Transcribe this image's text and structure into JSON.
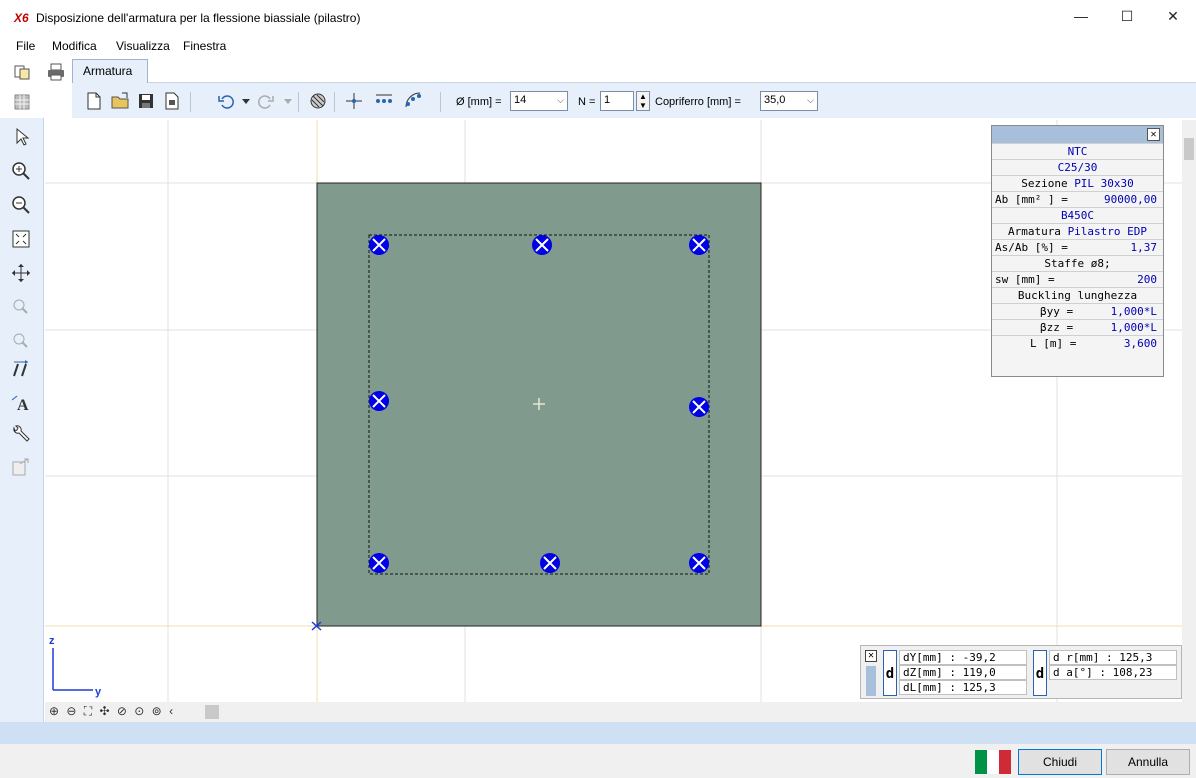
{
  "window": {
    "logo": "X6",
    "title": "Disposizione dell'armatura per la flessione biassiale (pilastro)",
    "minimize": "—",
    "maximize": "☐",
    "close": "✕"
  },
  "menu": {
    "file": "File",
    "modifica": "Modifica",
    "visualizza": "Visualizza",
    "finestra": "Finestra"
  },
  "tabs": {
    "armatura": "Armatura"
  },
  "toolbar": {
    "diameter_label": "Ø [mm] =",
    "diameter_value": "14",
    "n_label": "N =",
    "n_value": "1",
    "cover_label": "Copriferro [mm] =",
    "cover_value": "35,0"
  },
  "info_panel": {
    "norm": "NTC",
    "concrete": "C25/30",
    "section_label": "Sezione",
    "section_value": "PIL 30x30",
    "ab_label": "Ab [mm² ] =",
    "ab_value": "90000,00",
    "steel": "B450C",
    "armatura_label": "Armatura",
    "armatura_value": "Pilastro EDP",
    "asab_label": "As/Ab [%] =",
    "asab_value": "1,37",
    "staffe": "Staffe ø8;",
    "sw_label": "sw [mm] =",
    "sw_value": "200",
    "buckling": "Buckling lunghezza",
    "byy_label": "βyy =",
    "byy_value": "1,000*L",
    "bzz_label": "βzz =",
    "bzz_value": "1,000*L",
    "l_label": "L [m] =",
    "l_value": "3,600"
  },
  "axes": {
    "z": "z",
    "y": "y"
  },
  "measure": {
    "dy": "dY[mm] : -39,2",
    "dz": "dZ[mm] : 119,0",
    "dl": "dL[mm] : 125,3",
    "dr": "d r[mm] : 125,3",
    "da": "d    a[°] : 108,23",
    "d1": "d",
    "d2": "d"
  },
  "footer": {
    "chiudi": "Chiudi",
    "annulla": "Annulla",
    "flag_colors": [
      "#009246",
      "#ffffff",
      "#ce2b37"
    ]
  },
  "colors": {
    "section_fill": "#819a8e",
    "bar_fill": "#0000e6",
    "band": "#e6effa"
  }
}
